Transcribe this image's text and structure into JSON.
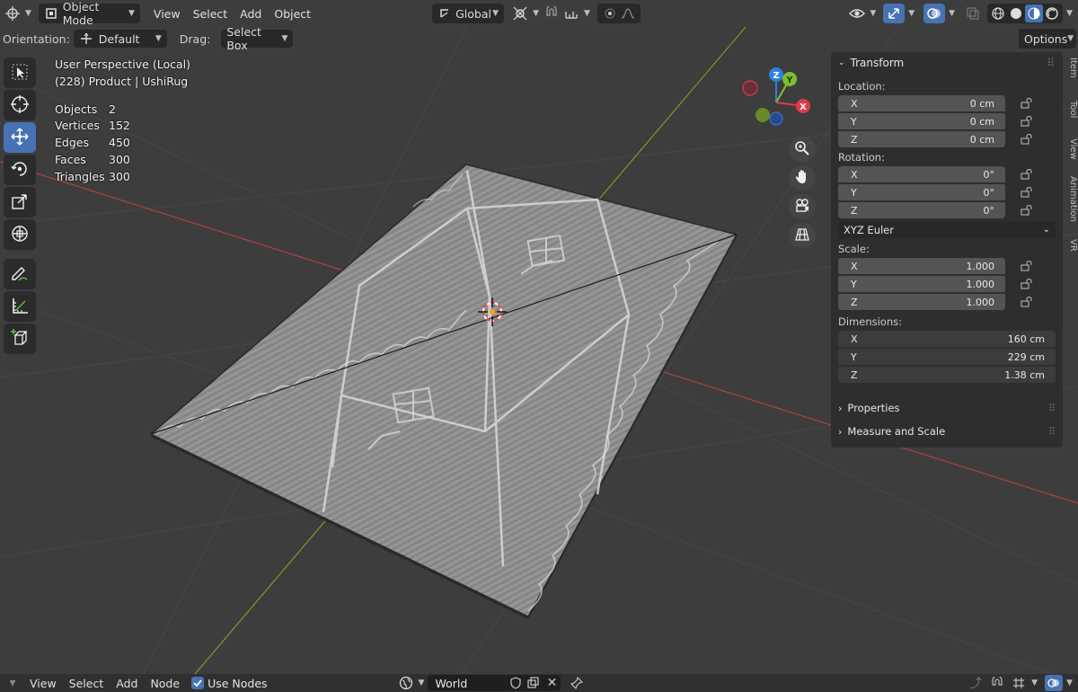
{
  "header": {
    "mode_label": "Object Mode",
    "menus": [
      "View",
      "Select",
      "Add",
      "Object"
    ],
    "transform_orientation": "Global"
  },
  "options_bar": {
    "orientation_label": "Orientation:",
    "orientation_value": "Default",
    "drag_label": "Drag:",
    "drag_value": "Select Box",
    "options_label": "Options"
  },
  "viewport_info": {
    "perspective": "User Perspective (Local)",
    "object": "(228) Product | UshiRug",
    "stats": [
      {
        "label": "Objects",
        "value": "2"
      },
      {
        "label": "Vertices",
        "value": "152"
      },
      {
        "label": "Edges",
        "value": "450"
      },
      {
        "label": "Faces",
        "value": "300"
      },
      {
        "label": "Triangles",
        "value": "300"
      }
    ]
  },
  "gizmo": {
    "x": "X",
    "y": "Y",
    "z": "Z"
  },
  "n_panel": {
    "title": "Transform",
    "location_label": "Location:",
    "location": [
      {
        "axis": "X",
        "value": "0 cm"
      },
      {
        "axis": "Y",
        "value": "0 cm"
      },
      {
        "axis": "Z",
        "value": "0 cm"
      }
    ],
    "rotation_label": "Rotation:",
    "rotation": [
      {
        "axis": "X",
        "value": "0°"
      },
      {
        "axis": "Y",
        "value": "0°"
      },
      {
        "axis": "Z",
        "value": "0°"
      }
    ],
    "rotation_mode": "XYZ Euler",
    "scale_label": "Scale:",
    "scale": [
      {
        "axis": "X",
        "value": "1.000"
      },
      {
        "axis": "Y",
        "value": "1.000"
      },
      {
        "axis": "Z",
        "value": "1.000"
      }
    ],
    "dimensions_label": "Dimensions:",
    "dimensions": [
      {
        "axis": "X",
        "value": "160 cm"
      },
      {
        "axis": "Y",
        "value": "229 cm"
      },
      {
        "axis": "Z",
        "value": "1.38 cm"
      }
    ],
    "properties_label": "Properties",
    "measure_label": "Measure and Scale"
  },
  "side_tabs": [
    "Item",
    "Tool",
    "View",
    "Animation",
    "VR"
  ],
  "bottom_bar": {
    "menus": [
      "View",
      "Select",
      "Add",
      "Node"
    ],
    "use_nodes_label": "Use Nodes",
    "world_name": "World"
  },
  "colors": {
    "accent": "#4772b3",
    "axis_x": "#ff3352",
    "axis_y": "#8bdc00",
    "axis_z": "#2890ff"
  }
}
